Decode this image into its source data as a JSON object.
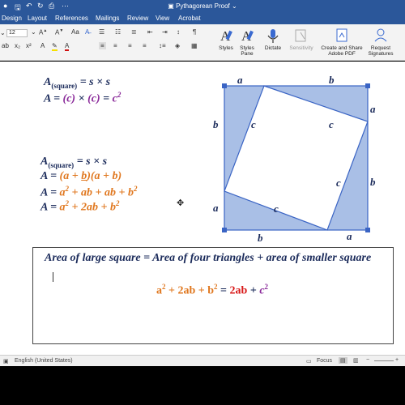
{
  "titlebar": {
    "title": "Pythagorean Proof",
    "save_icon": "save-icon",
    "undo_icon": "undo-icon",
    "redo_icon": "redo-icon",
    "print_icon": "print-icon",
    "more_icon": "more-icon"
  },
  "menubar": {
    "tabs": [
      "Design",
      "Layout",
      "References",
      "Mailings",
      "Review",
      "View",
      "Acrobat"
    ]
  },
  "ribbon": {
    "font_size": "12",
    "styles_label": "Styles",
    "styles_pane_label": "Styles\nPane",
    "dictate_label": "Dictate",
    "sensitivity_label": "Sensitivity",
    "create_share_label": "Create and Share\nAdobe PDF",
    "request_sign_label": "Request\nSignatures"
  },
  "document": {
    "eq1_line1": {
      "A": "A",
      "sub": "(square)",
      "rest": " = s × s"
    },
    "eq1_line2": {
      "pre": "A = ",
      "c1": "(c)",
      "mid": " × ",
      "c2": "(c)",
      "eq": " = ",
      "c": "c",
      "exp": "2"
    },
    "eq2_line1": {
      "A": "A",
      "sub": "(square)",
      "rest": " = s × s"
    },
    "eq2_line2": {
      "pre": "A = ",
      "open1": "(",
      "a1": "a",
      "plus1": " + ",
      "b1": "b",
      "close1": ")",
      "open2": "(",
      "a2": "a",
      "plus2": " + ",
      "b2": "b",
      "close2": ")"
    },
    "eq2_line3": {
      "pre": "A = ",
      "a": "a",
      "exp": "2",
      "mid": " + ab + ab + ",
      "b": "b",
      "exp2": "2"
    },
    "eq2_line4": {
      "pre": "A = ",
      "a": "a",
      "exp": "2",
      "mid": " + 2ab + ",
      "b": "b",
      "exp2": "2"
    },
    "diagram": {
      "top_a": "a",
      "top_b": "b",
      "right_a": "a",
      "right_b": "b",
      "bottom_b": "b",
      "bottom_a": "a",
      "left_b": "b",
      "left_a": "a",
      "c_labels": [
        "c",
        "c",
        "c",
        "c"
      ]
    },
    "box": {
      "heading": "Area of large square = Area of four triangles + area of smaller square",
      "f_a": "a",
      "f_a_exp": "2",
      "f_mid": " + 2ab + ",
      "f_b": "b",
      "f_b_exp": "2",
      "f_eq": " = ",
      "f_2ab": "2ab",
      "f_plus": " + ",
      "f_c": "c",
      "f_c_exp": "2"
    }
  },
  "statusbar": {
    "language": "English (United States)",
    "focus": "Focus"
  },
  "colors": {
    "title_bar": "#2b579a",
    "square_fill": "#a9bfe6",
    "square_stroke": "#3a64c4",
    "equation_navy": "#1a2a5a",
    "purple": "#8a2a9a",
    "orange": "#e07820",
    "red": "#d81a1a"
  }
}
